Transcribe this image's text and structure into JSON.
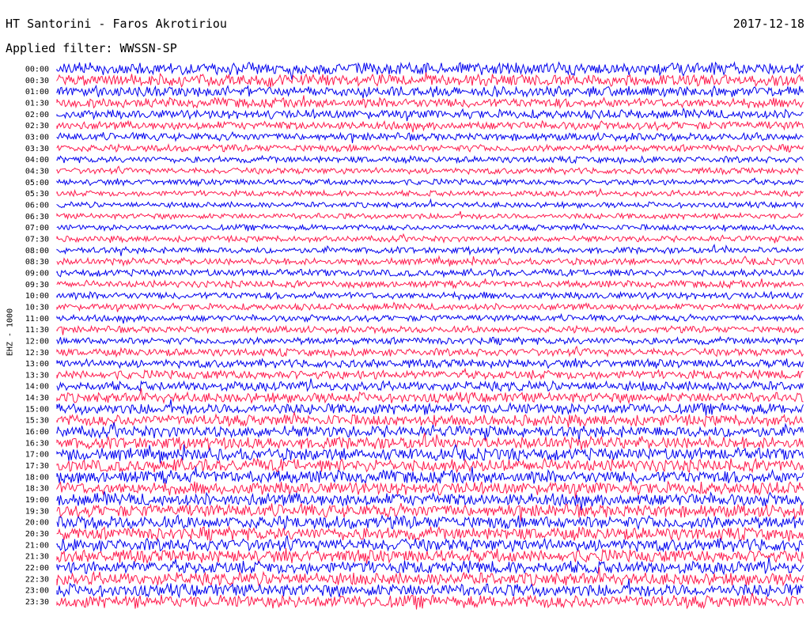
{
  "header": {
    "title": "HT Santorini - Faros Akrotiriou",
    "date": "2017-12-18",
    "filter": "Applied filter: WWSSN-SP"
  },
  "chart_data": {
    "type": "line",
    "title": "HT Santorini - Faros Akrotiriou",
    "channel_label": "EHZ - 1000",
    "rows": [
      "00:00",
      "00:30",
      "01:00",
      "01:30",
      "02:00",
      "02:30",
      "03:00",
      "03:30",
      "04:00",
      "04:30",
      "05:00",
      "05:30",
      "06:00",
      "06:30",
      "07:00",
      "07:30",
      "08:00",
      "08:30",
      "09:00",
      "09:30",
      "10:00",
      "10:30",
      "11:00",
      "11:30",
      "12:00",
      "12:30",
      "13:00",
      "13:30",
      "14:00",
      "14:30",
      "15:00",
      "15:30",
      "16:00",
      "16:30",
      "17:00",
      "17:30",
      "18:00",
      "18:30",
      "19:00",
      "19:30",
      "20:00",
      "20:30",
      "21:00",
      "21:30",
      "22:00",
      "22:30",
      "23:00",
      "23:30"
    ],
    "row_amplitude": [
      0.95,
      0.9,
      0.8,
      0.75,
      0.7,
      0.65,
      0.6,
      0.55,
      0.5,
      0.48,
      0.46,
      0.45,
      0.44,
      0.44,
      0.45,
      0.46,
      0.5,
      0.52,
      0.55,
      0.55,
      0.55,
      0.52,
      0.5,
      0.52,
      0.55,
      0.6,
      0.65,
      0.7,
      0.75,
      0.8,
      0.85,
      0.88,
      0.9,
      0.95,
      0.97,
      1.0,
      1.0,
      1.0,
      1.0,
      1.0,
      1.0,
      1.0,
      1.0,
      1.0,
      1.0,
      1.0,
      1.0,
      1.0
    ],
    "colors": [
      "#0000ee",
      "#ff1a4d"
    ],
    "grid": false
  }
}
